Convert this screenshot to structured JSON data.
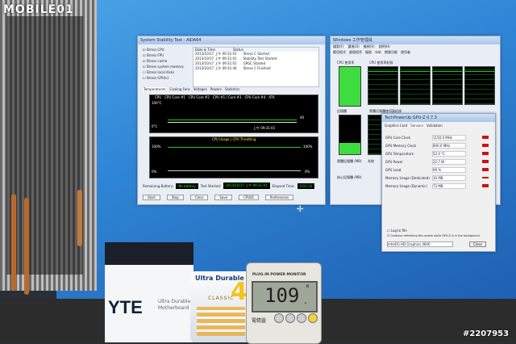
{
  "watermark": {
    "logo": "MOBILE01",
    "image_number": "#2207953"
  },
  "stability_window": {
    "title": "System Stability Test - AIDA64",
    "checks": [
      "Stress CPU",
      "Stress FPU",
      "Stress cache",
      "Stress system memory",
      "Stress local disks",
      "Stress GPU(s)"
    ],
    "log_header": [
      "Date & Time",
      "Status"
    ],
    "log_rows": [
      [
        "2013/10/17 上午 09:31:01",
        "Stress C Started"
      ],
      [
        "2013/10/17 上午 09:31:01",
        "Stability Test Started"
      ],
      [
        "2013/10/17 上午 09:31:01",
        "GPGC Started"
      ],
      [
        "2013/10/17 上午 09:31:40",
        "Stress C Finished"
      ]
    ],
    "tabs": [
      "Temperatures",
      "Cooling Fans",
      "Voltages",
      "Powers",
      "Statistics"
    ],
    "temp_legend": [
      "CPU",
      "CPU Core #1",
      "CPU Core #2",
      "CPU #1 / Core #3",
      "CPU Core #4",
      "ATA"
    ],
    "temp_top": "100°C",
    "temp_bottom": "0°C",
    "temp_value": "40",
    "temp_time": "上午 09:31:01",
    "usage_title": "CPU Usage | CPU Throttling",
    "usage_top": "100%",
    "usage_bottom": "0%",
    "usage_right_top": "100%",
    "usage_right_bottom": "0%",
    "footer": {
      "battery_label": "Remaining Battery:",
      "battery_value": "No battery",
      "started_label": "Test Started:",
      "started_value": "2013/10/17 上午 09:31:01",
      "elapsed_label": "Elapsed Time:",
      "elapsed_value": "0:01:14"
    },
    "buttons": [
      "Start",
      "Stop",
      "Clear",
      "Save",
      "CPUID",
      "Preferences"
    ]
  },
  "task_manager": {
    "title": "Windows 工作管理員",
    "menu": [
      "檔案(F)",
      "選項(O)",
      "檢視(V)",
      "說明(H)"
    ],
    "tabs": [
      "應用程式",
      "處理程序",
      "服務",
      "效能",
      "網路功能",
      "使用者"
    ],
    "cpu_usage_label": "CPU 使用率",
    "cpu_history_label": "CPU 使用率紀錄",
    "cpu_percent": "100 %",
    "cpu_percent_value": 1.0,
    "memory_label": "記憶體",
    "memory_history_label": "實體記憶體使用量紀錄",
    "memory_value": "1.39 GB",
    "memory_fill": 0.3,
    "section_labels": [
      "實體記憶體 (MB)",
      "核心記憶體 (MB)",
      "系統"
    ]
  },
  "gpuz": {
    "title": "TechPowerUp GPU-Z 0.7.3",
    "tabs": [
      "Graphics Card",
      "Sensors",
      "Validation"
    ],
    "rows": [
      [
        "GPU Core Clock",
        "1150.0 MHz"
      ],
      [
        "GPU Memory Clock",
        "800.0 MHz"
      ],
      [
        "GPU Temperature",
        "52.0 °C"
      ],
      [
        "GPU Power",
        "22.7 W"
      ],
      [
        "GPU Load",
        "99 %"
      ],
      [
        "Memory Usage (Dedicated)",
        "16 MB"
      ],
      [
        "Memory Usage (Dynamic)",
        "73 MB"
      ]
    ],
    "log_label": "Log to file",
    "continue_label": "Continue refreshing this screen while GPU-Z is in the background",
    "select_value": "Intel(R) HD Graphics 4600",
    "close_label": "Close"
  },
  "power_meter": {
    "brand_label": "PLUG-IN POWER MONITOR",
    "reading": "109",
    "decimal": ".",
    "unit_marker": "W",
    "maker_mark": "電精靈"
  },
  "box_art": {
    "brand_fragment": "YTE",
    "line1": "Ultra Durable",
    "line2": "Motherboard",
    "logo_main": "Ultra Durable",
    "logo_number": "4",
    "logo_sub": "CLASSIC"
  },
  "colors": {
    "desktop_blue": "#2f86d6",
    "graph_green": "#1dc51d",
    "gpu_bar_red": "#d01010"
  }
}
